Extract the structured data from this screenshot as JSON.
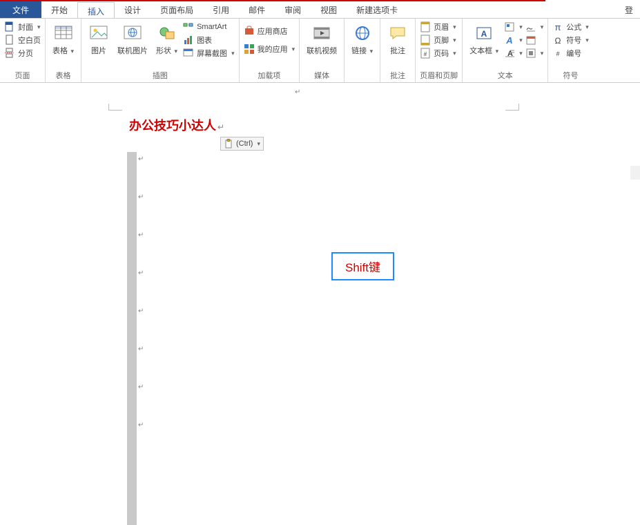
{
  "tabs": {
    "file": "文件",
    "home": "开始",
    "insert": "插入",
    "design": "设计",
    "layout": "页面布局",
    "references": "引用",
    "mail": "邮件",
    "review": "审阅",
    "view": "视图",
    "newtab": "新建选项卡",
    "login": "登"
  },
  "pages_group": {
    "cover": "封面",
    "blank": "空白页",
    "break": "分页",
    "label": "页面"
  },
  "tables_group": {
    "table": "表格",
    "label": "表格"
  },
  "illustrations_group": {
    "picture": "图片",
    "online_pic": "联机图片",
    "shapes": "形状",
    "smartart": "SmartArt",
    "chart": "图表",
    "screenshot": "屏幕截图",
    "label": "插图"
  },
  "addins_group": {
    "store": "应用商店",
    "myapps": "我的应用",
    "label": "加载项"
  },
  "media_group": {
    "online_video": "联机视频",
    "label": "媒体"
  },
  "links_group": {
    "link": "链接",
    "label": ""
  },
  "comments_group": {
    "comment": "批注",
    "label": "批注"
  },
  "headerfooter_group": {
    "header": "页眉",
    "footer": "页脚",
    "pagenum": "页码",
    "label": "页眉和页脚"
  },
  "text_group": {
    "textbox": "文本框",
    "label": "文本"
  },
  "symbols_group": {
    "equation": "公式",
    "symbol": "符号",
    "number": "编号",
    "label": "符号"
  },
  "document": {
    "title": "办公技巧小达人",
    "ctrl_badge": "(Ctrl)",
    "shift_box": "Shift键"
  }
}
